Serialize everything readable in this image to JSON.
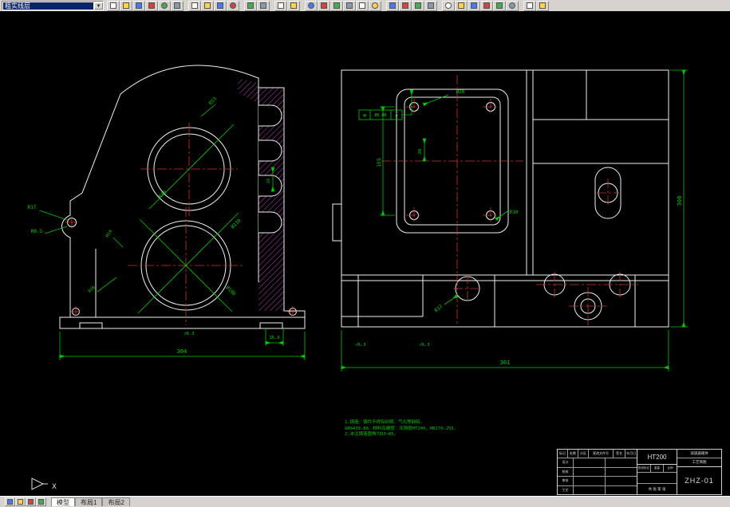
{
  "app": {
    "combo_style": "粗实线层"
  },
  "toolbar": {
    "icons": [
      "new",
      "open",
      "save",
      "print",
      "print-preview",
      "find",
      "cut",
      "copy",
      "paste",
      "format-painter",
      "undo",
      "redo",
      "insert-block",
      "insert-image",
      "zoom-window",
      "zoom-in",
      "zoom-out",
      "zoom-all",
      "pan",
      "redraw",
      "layers",
      "linetype",
      "line-width",
      "color",
      "line",
      "circle",
      "arc",
      "text",
      "dimension",
      "measure",
      "options",
      "help"
    ],
    "gaps": [
      6,
      10,
      12,
      14,
      20,
      24,
      30
    ]
  },
  "statusbar": {
    "buttons": [
      "snap",
      "grid",
      "ortho",
      "polar"
    ],
    "tabs": [
      "模型",
      "布局1",
      "布局2"
    ]
  },
  "ucs": {
    "axis": "X"
  },
  "notes": {
    "line1": "1.铸造：铸件不得有砂眼、气孔等缺陷，",
    "line2": "GB9439-88。材料及硬度：灰铸铁HT200，HB170-255。",
    "line3": "2.未注铸造圆角为R3~R5。"
  },
  "left_view": {
    "r53": "R53",
    "r40": "R40",
    "r17": "R17",
    "r8_5": "R8.5",
    "r14": "R14",
    "r16": "R16",
    "d110": "Ø110",
    "d100": "Ø100",
    "w304": "304",
    "n16_9": "16.9",
    "n24": "24",
    "rough": "√6.3"
  },
  "right_view": {
    "h155": "155",
    "n20": "20",
    "d20": "Ø20",
    "r10": "R10",
    "r12": "R12",
    "w301": "301",
    "h308": "308",
    "rough1": "√6.3",
    "rough2": "√6.3",
    "fcf": {
      "symbol": "⊕",
      "tolerance": "Ø0.08",
      "datum": "A"
    }
  },
  "title_block": {
    "material": "HT200",
    "code": "ZHZ-01",
    "part_name": "减速器箱体",
    "sheet_type": "工艺简图",
    "admin": [
      "标记",
      "处数",
      "分区",
      "更改文件号",
      "签名",
      "年月日"
    ],
    "roles": [
      "设计",
      "校核",
      "审核",
      "工艺"
    ],
    "misc": [
      "阶段标记",
      "重量",
      "比例"
    ],
    "sheet": "共 张 第 张"
  }
}
